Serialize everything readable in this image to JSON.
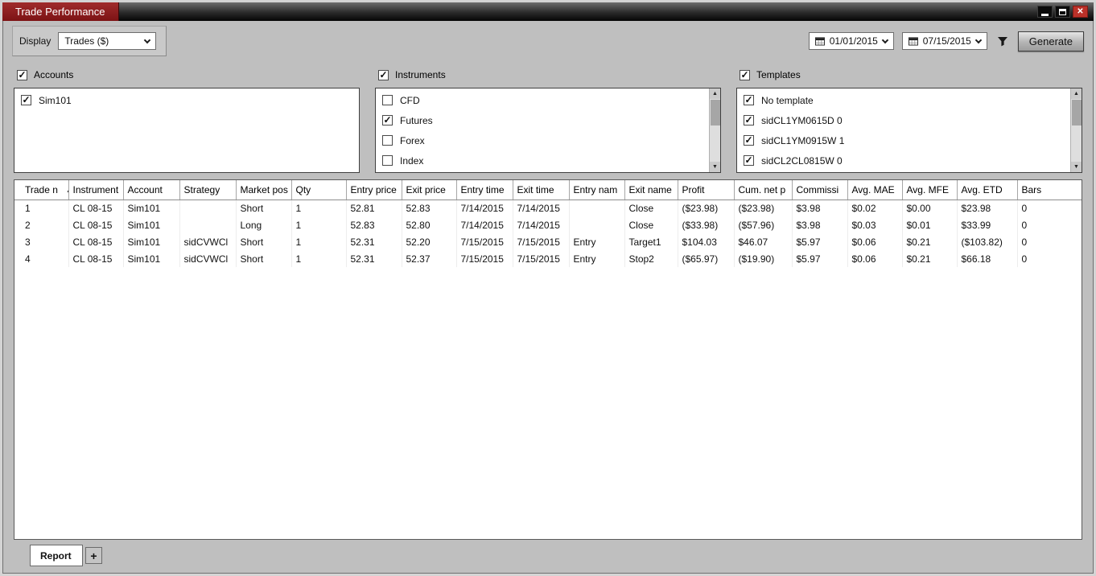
{
  "window": {
    "title": "Trade Performance"
  },
  "toolbar": {
    "display_label": "Display",
    "display_value": "Trades ($)",
    "date_from": "01/01/2015",
    "date_to": "07/15/2015",
    "generate_label": "Generate"
  },
  "filters": {
    "accounts": {
      "label": "Accounts",
      "checked": true,
      "items": [
        {
          "label": "Sim101",
          "checked": true
        }
      ]
    },
    "instruments": {
      "label": "Instruments",
      "checked": true,
      "items": [
        {
          "label": "CFD",
          "checked": false
        },
        {
          "label": "Futures",
          "checked": true
        },
        {
          "label": "Forex",
          "checked": false
        },
        {
          "label": "Index",
          "checked": false
        }
      ]
    },
    "templates": {
      "label": "Templates",
      "checked": true,
      "items": [
        {
          "label": "No template",
          "checked": true
        },
        {
          "label": "sidCL1YM0615D 0",
          "checked": true
        },
        {
          "label": "sidCL1YM0915W 1",
          "checked": true
        },
        {
          "label": "sidCL2CL0815W 0",
          "checked": true
        }
      ]
    }
  },
  "table": {
    "sorted_column": 0,
    "sort_direction": "asc",
    "columns": [
      "Trade n",
      "Instrument",
      "Account",
      "Strategy",
      "Market pos",
      "Qty",
      "Entry price",
      "Exit price",
      "Entry time",
      "Exit time",
      "Entry nam",
      "Exit name",
      "Profit",
      "Cum. net p",
      "Commissi",
      "Avg. MAE",
      "Avg. MFE",
      "Avg. ETD",
      "Bars"
    ],
    "rows": [
      [
        "1",
        "CL 08-15",
        "Sim101",
        "",
        "Short",
        "1",
        "52.81",
        "52.83",
        "7/14/2015",
        "7/14/2015",
        "",
        "Close",
        "($23.98)",
        "($23.98)",
        "$3.98",
        "$0.02",
        "$0.00",
        "$23.98",
        "0"
      ],
      [
        "2",
        "CL 08-15",
        "Sim101",
        "",
        "Long",
        "1",
        "52.83",
        "52.80",
        "7/14/2015",
        "7/14/2015",
        "",
        "Close",
        "($33.98)",
        "($57.96)",
        "$3.98",
        "$0.03",
        "$0.01",
        "$33.99",
        "0"
      ],
      [
        "3",
        "CL 08-15",
        "Sim101",
        "sidCVWCl",
        "Short",
        "1",
        "52.31",
        "52.20",
        "7/15/2015",
        "7/15/2015",
        "Entry",
        "Target1",
        "$104.03",
        "$46.07",
        "$5.97",
        "$0.06",
        "$0.21",
        "($103.82)",
        "0"
      ],
      [
        "4",
        "CL 08-15",
        "Sim101",
        "sidCVWCl",
        "Short",
        "1",
        "52.31",
        "52.37",
        "7/15/2015",
        "7/15/2015",
        "Entry",
        "Stop2",
        "($65.97)",
        "($19.90)",
        "$5.97",
        "$0.06",
        "$0.21",
        "$66.18",
        "0"
      ]
    ]
  },
  "tabs": {
    "report": "Report",
    "add": "+"
  },
  "colors": {
    "negative": "#c00000",
    "title_tab": "#8c1a1a"
  }
}
